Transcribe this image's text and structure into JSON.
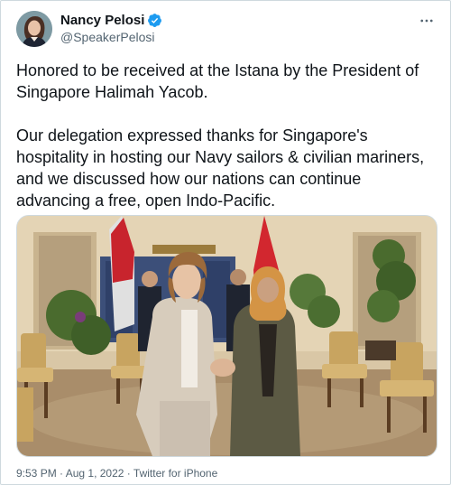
{
  "author": {
    "name": "Nancy Pelosi",
    "handle": "@SpeakerPelosi",
    "verified_icon": "verified-badge-icon",
    "more_icon": "more-options-icon"
  },
  "tweet": {
    "paragraph_1": "Honored to be received at the Istana by the President of Singapore Halimah Yacob.",
    "paragraph_2": "Our delegation expressed thanks for Singapore's hospitality in hosting our Navy sailors & civilian mariners, and we discussed how our nations can continue advancing a free, open Indo-Pacific."
  },
  "meta": {
    "time": "9:53 PM",
    "separator": " · ",
    "date": "Aug 1, 2022",
    "source": "Twitter for iPhone"
  },
  "colors": {
    "accent": "#1d9bf0",
    "secondary_text": "#536471",
    "border": "#cfd9de"
  }
}
